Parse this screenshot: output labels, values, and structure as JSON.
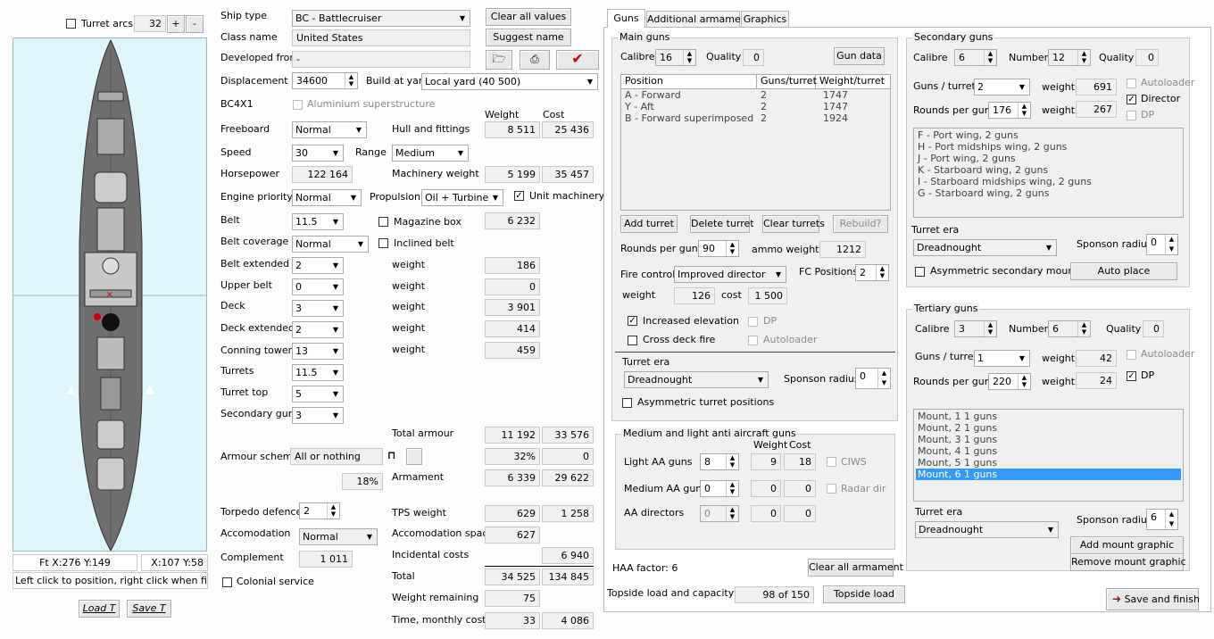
{
  "left": {
    "turret_arcs": "Turret arcs",
    "arcs_value": "32",
    "plus": "+",
    "minus": "-",
    "coords_ft": "Ft X:276 Y:149",
    "coords_x": "X:107 Y:58",
    "hint": "Left click to position, right click when finished",
    "load": "Load T",
    "save": "Save T"
  },
  "general": {
    "ship_type_label": "Ship type",
    "ship_type": "BC - Battlecruiser",
    "class_name_label": "Class name",
    "class_name": "United States",
    "developed_label": "Developed from",
    "developed": "-",
    "displacement_label": "Displacement",
    "displacement": "34600",
    "build_label": "Build at yard",
    "build": "Local yard (40 500)",
    "design_id": "BC4X1",
    "alu_label": "Aluminium superstructure",
    "clear_values": "Clear all values",
    "suggest_name": "Suggest name",
    "weight_hdr": "Weight",
    "cost_hdr": "Cost",
    "freeboard_label": "Freeboard",
    "freeboard": "Normal",
    "hull_label": "Hull and fittings",
    "hull_w": "8 511",
    "hull_c": "25 436",
    "speed_label": "Speed",
    "speed": "30",
    "range_label": "Range",
    "range": "Medium",
    "hp_label": "Horsepower",
    "hp": "122 164",
    "mach_label": "Machinery weight",
    "mach_w": "5 199",
    "mach_c": "35 457",
    "engine_label": "Engine priority",
    "engine": "Normal",
    "prop_label": "Propulsion",
    "prop": "Oil + Turbine",
    "unit_mach": "Unit machinery",
    "belt_label": "Belt",
    "belt": "11.5",
    "mag_box": "Magazine box",
    "belt_w": "6 232",
    "belt_cov_label": "Belt coverage",
    "belt_cov": "Normal",
    "inclined": "Inclined belt",
    "belt_ext_label": "Belt extended",
    "belt_ext": "2",
    "belt_ext_w": "186",
    "upper_label": "Upper belt",
    "upper": "0",
    "upper_w": "0",
    "deck_label": "Deck",
    "deck": "3",
    "deck_w": "3 901",
    "deck_ext_label": "Deck extended",
    "deck_ext": "2",
    "deck_ext_w": "414",
    "ct_label": "Conning tower",
    "ct": "13",
    "ct_w": "459",
    "turrets_label": "Turrets",
    "turrets": "11.5",
    "tt_label": "Turret top",
    "tt": "5",
    "sec_label": "Secondary guns",
    "sec": "3",
    "weight_word": "weight",
    "total_armour_label": "Total armour",
    "total_armour_w": "11 192",
    "total_armour_c": "33 576",
    "armour_scheme_label": "Armour scheme",
    "armour_scheme": "All or nothing",
    "pct1": "32%",
    "pct1_c": "0",
    "pct2": "18%",
    "arm_label": "Armament",
    "arm_w": "6 339",
    "arm_c": "29 622",
    "torp_label": "Torpedo defence",
    "torp": "2",
    "tps_label": "TPS weight",
    "tps_w": "629",
    "tps_c": "1 258",
    "accom_label": "Accomodation",
    "accom": "Normal",
    "accom_space_label": "Accomodation space",
    "accom_space": "627",
    "compl_label": "Complement",
    "compl": "1 011",
    "incid_label": "Incidental costs",
    "incid": "6 940",
    "total_label": "Total",
    "total_w": "34 525",
    "total_c": "134 845",
    "colonial": "Colonial service",
    "weight_rem_label": "Weight remaining",
    "weight_rem": "75",
    "time_label": "Time, monthly cost",
    "time": "33",
    "monthly": "4 086"
  },
  "tabs": [
    "Guns",
    "Additional armament",
    "Graphics"
  ],
  "main": {
    "title": "Main guns",
    "calibre_label": "Calibre",
    "calibre": "16",
    "quality_label": "Quality",
    "quality": "0",
    "gun_data": "Gun data",
    "cols": [
      "Position",
      "Guns/turret",
      "Weight/turret"
    ],
    "rows": [
      [
        "A - Forward",
        "2",
        "1747"
      ],
      [
        "Y - Aft",
        "2",
        "1747"
      ],
      [
        "B - Forward superimposed",
        "2",
        "1924"
      ]
    ],
    "add_turret": "Add turret",
    "delete_turret": "Delete turret",
    "clear_turrets": "Clear turrets",
    "rebuild": "Rebuild?",
    "rpg_label": "Rounds per gun",
    "rpg": "90",
    "ammo_label": "ammo weight",
    "ammo": "1212",
    "fire_label": "Fire control",
    "fire": "Improved director",
    "fc_label": "FC Positions",
    "fc": "2",
    "weight_label": "weight",
    "weight": "126",
    "cost_label": "cost",
    "cost": "1 500",
    "incr_elev": "Increased elevation",
    "dp": "DP",
    "cross_deck": "Cross deck fire",
    "autoloader": "Autoloader",
    "era_label": "Turret era",
    "era": "Dreadnought",
    "sponson_label": "Sponson radius",
    "sponson": "0",
    "asym": "Asymmetric turret positions"
  },
  "aa": {
    "title": "Medium and light anti aircraft guns",
    "weight_hdr": "Weight",
    "cost_hdr": "Cost",
    "light_label": "Light AA guns",
    "light": "8",
    "light_w": "9",
    "light_c": "18",
    "ciws": "CIWS",
    "medium_label": "Medium AA guns",
    "medium": "0",
    "medium_w": "0",
    "medium_c": "0",
    "radar": "Radar dir",
    "dir_label": "AA directors",
    "dir": "0",
    "dir_w": "0",
    "dir_c": "0",
    "haa": "HAA factor: 6",
    "clear_arm": "Clear all armament"
  },
  "topside": {
    "label": "Topside load and capacity",
    "value": "98 of 150",
    "button": "Topside load"
  },
  "secondary": {
    "title": "Secondary guns",
    "calibre_label": "Calibre",
    "calibre": "6",
    "number_label": "Number",
    "number": "12",
    "quality_label": "Quality",
    "quality": "0",
    "gpt_label": "Guns / turret",
    "gpt": "2",
    "weight_label": "weight",
    "weight": "691",
    "autoloader": "Autoloader",
    "director": "Director",
    "rpg_label": "Rounds per gun",
    "rpg": "176",
    "weight2": "267",
    "dp": "DP",
    "mounts": [
      "F - Port wing, 2 guns",
      "H - Port midships wing, 2 guns",
      "J - Port wing, 2 guns",
      "K - Starboard wing, 2 guns",
      "I - Starboard midships wing, 2 guns",
      "G - Starboard wing, 2 guns"
    ],
    "era_label": "Turret era",
    "era": "Dreadnought",
    "sponson_label": "Sponson radius",
    "sponson": "0",
    "asym": "Asymmetric secondary mounts",
    "auto_place": "Auto place"
  },
  "tertiary": {
    "title": "Tertiary guns",
    "calibre_label": "Calibre",
    "calibre": "3",
    "number_label": "Number",
    "number": "6",
    "quality_label": "Quality",
    "quality": "0",
    "gpt_label": "Guns / turret",
    "gpt": "1",
    "weight_label": "weight",
    "weight": "42",
    "autoloader": "Autoloader",
    "rpg_label": "Rounds per gun",
    "rpg": "220",
    "weight2": "24",
    "dp": "DP",
    "mounts": [
      "Mount, 1 1 guns",
      "Mount, 2 1 guns",
      "Mount, 3 1 guns",
      "Mount, 4 1 guns",
      "Mount, 5 1 guns",
      "Mount, 6 1 guns"
    ],
    "selected_index": 5,
    "era_label": "Turret era",
    "era": "Dreadnought",
    "sponson_label": "Sponson radius",
    "sponson": "6",
    "add_mount": "Add mount graphic",
    "remove_mount": "Remove mount graphic"
  },
  "save_finish": "Save and finish",
  "colors": {
    "selection": "#3399ff",
    "ship_bg": "#dff6fd",
    "hull": "#6e6e6e",
    "check_red": "#cc0000",
    "arrow": "#8b1a1a"
  }
}
